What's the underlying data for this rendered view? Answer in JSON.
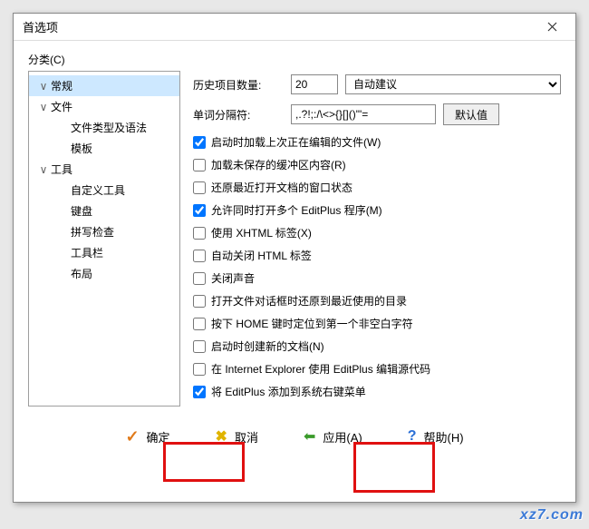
{
  "dialog": {
    "title": "首选项",
    "category_label": "分类(C)"
  },
  "tree": [
    {
      "label": "常规",
      "expander": "∨",
      "indent": 0,
      "selected": true
    },
    {
      "label": "文件",
      "expander": "∨",
      "indent": 0,
      "selected": false
    },
    {
      "label": "文件类型及语法",
      "expander": "",
      "indent": 2,
      "selected": false
    },
    {
      "label": "模板",
      "expander": "",
      "indent": 2,
      "selected": false
    },
    {
      "label": "工具",
      "expander": "∨",
      "indent": 0,
      "selected": false
    },
    {
      "label": "自定义工具",
      "expander": "",
      "indent": 2,
      "selected": false
    },
    {
      "label": "键盘",
      "expander": "",
      "indent": 2,
      "selected": false
    },
    {
      "label": "拼写检查",
      "expander": "",
      "indent": 2,
      "selected": false
    },
    {
      "label": "工具栏",
      "expander": "",
      "indent": 2,
      "selected": false
    },
    {
      "label": "布局",
      "expander": "",
      "indent": 2,
      "selected": false
    }
  ],
  "form": {
    "history_label": "历史项目数量:",
    "history_value": "20",
    "suggest_value": "自动建议",
    "delimiter_label": "单词分隔符:",
    "delimiter_value": ",.?!;:/\\<>{}[]()\"'=",
    "default_btn": "默认值"
  },
  "checks": [
    {
      "label": "启动时加载上次正在编辑的文件(W)",
      "checked": true,
      "hotkey": "W"
    },
    {
      "label": "加载未保存的缓冲区内容(R)",
      "checked": false,
      "hotkey": "R"
    },
    {
      "label": "还原最近打开文档的窗口状态",
      "checked": false,
      "hotkey": ""
    },
    {
      "label": "允许同时打开多个 EditPlus 程序(M)",
      "checked": true,
      "hotkey": "M"
    },
    {
      "label": "使用 XHTML 标签(X)",
      "checked": false,
      "hotkey": "X"
    },
    {
      "label": "自动关闭 HTML 标签",
      "checked": false,
      "hotkey": ""
    },
    {
      "label": "关闭声音",
      "checked": false,
      "hotkey": ""
    },
    {
      "label": "打开文件对话框时还原到最近使用的目录",
      "checked": false,
      "hotkey": ""
    },
    {
      "label": "按下 HOME 键时定位到第一个非空白字符",
      "checked": false,
      "hotkey": ""
    },
    {
      "label": "启动时创建新的文档(N)",
      "checked": false,
      "hotkey": "N"
    },
    {
      "label": "在 Internet Explorer 使用 EditPlus 编辑源代码",
      "checked": false,
      "hotkey": ""
    },
    {
      "label": "将 EditPlus 添加到系统右键菜单",
      "checked": true,
      "hotkey": ""
    }
  ],
  "buttons": {
    "ok": "确定",
    "cancel": "取消",
    "apply": "应用(A)",
    "help": "帮助(H)"
  },
  "watermark": "xz7.com"
}
